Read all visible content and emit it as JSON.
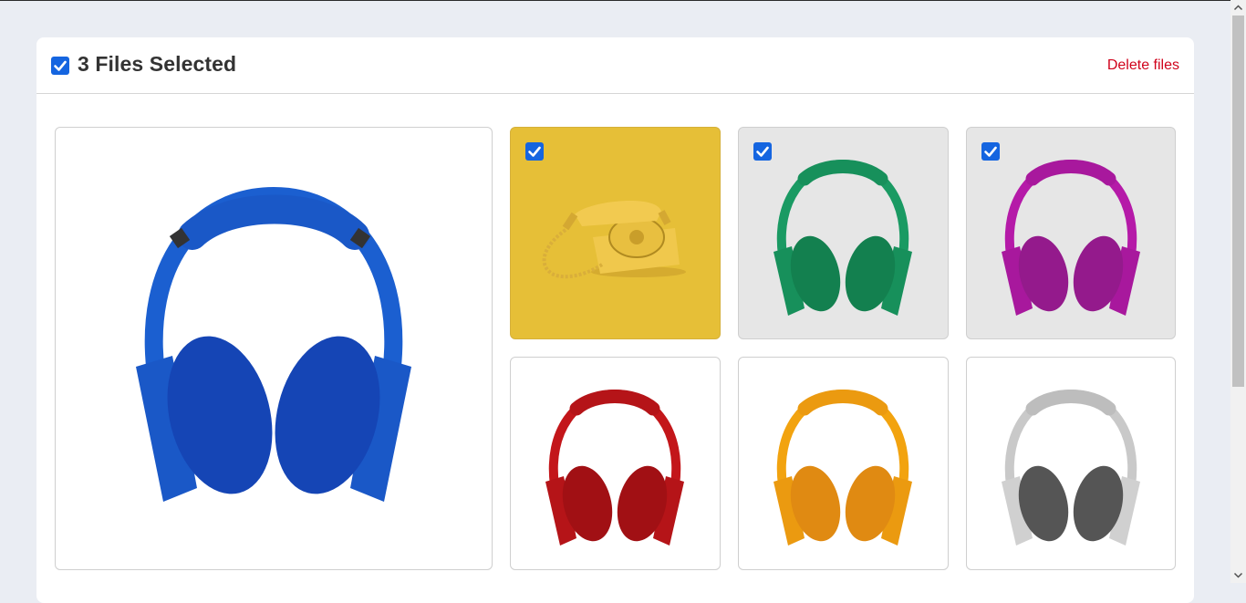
{
  "header": {
    "title": "3 Files Selected",
    "delete_label": "Delete files",
    "all_selected": true
  },
  "colors": {
    "accent": "#1565e0",
    "danger": "#d0021b",
    "yellow_tile": "#e6bf37",
    "selected_tile": "#e6e6e6"
  },
  "files": [
    {
      "name": "headphones-blue",
      "color": "#1b5fd0",
      "pad": "#1545b5",
      "selected": false
    },
    {
      "name": "telephone-yellow",
      "color": "#e2b63a",
      "selected": true
    },
    {
      "name": "headphones-green",
      "color": "#1a9a63",
      "pad": "#13804f",
      "selected": true
    },
    {
      "name": "headphones-magenta",
      "color": "#b51aa8",
      "pad": "#941a8c",
      "selected": true
    },
    {
      "name": "headphones-red",
      "color": "#c3161a",
      "pad": "#a11014",
      "selected": false
    },
    {
      "name": "headphones-orange",
      "color": "#f2a30f",
      "pad": "#e08a12",
      "selected": false
    },
    {
      "name": "headphones-gray",
      "color": "#c9c9c9",
      "pad": "#555555",
      "selected": false
    }
  ]
}
